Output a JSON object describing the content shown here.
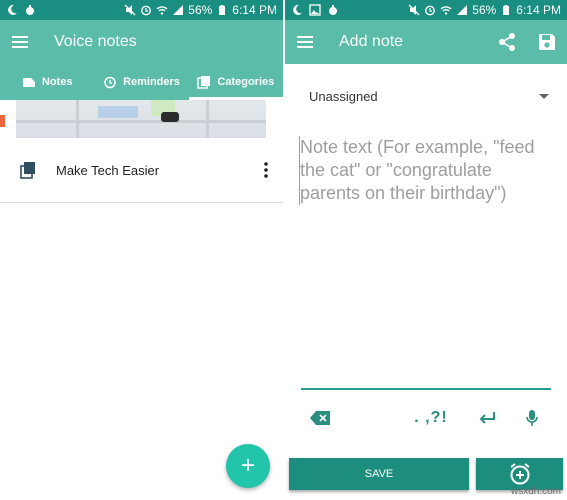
{
  "status_bar": {
    "battery": "56%",
    "time": "6:14 PM"
  },
  "left": {
    "app_title": "Voice notes",
    "tabs": [
      {
        "label": "Notes",
        "icon": "notes-icon"
      },
      {
        "label": "Reminders",
        "icon": "alarm-clock-icon"
      },
      {
        "label": "Categories",
        "icon": "categories-icon",
        "active": true
      }
    ],
    "category_item": {
      "label": "Make Tech Easier",
      "icon": "category-icon"
    },
    "fab_label": "+"
  },
  "right": {
    "app_title": "Add note",
    "category_select": {
      "selected": "Unassigned"
    },
    "note_placeholder": "Note text (For example, \"feed the cat\" or \"congratulate parents on their birthday\")",
    "toolbar": {
      "punctuation": ". ,?!"
    },
    "save_label": "SAVE"
  },
  "watermark": "wsxdn.com",
  "colors": {
    "appbar": "#5bbcaa",
    "statusbar": "#1a8f81",
    "accent": "#22c4aa",
    "button": "#1d8e7d"
  }
}
